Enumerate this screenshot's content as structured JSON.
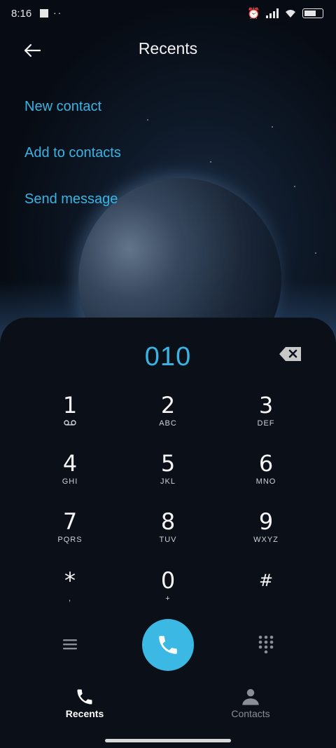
{
  "status_bar": {
    "time": "8:16"
  },
  "header": {
    "title": "Recents"
  },
  "menu": [
    {
      "label": "New contact"
    },
    {
      "label": "Add to contacts"
    },
    {
      "label": "Send message"
    }
  ],
  "dialer": {
    "number": "010",
    "keys": [
      {
        "digit": "1",
        "letters": ""
      },
      {
        "digit": "2",
        "letters": "ABC"
      },
      {
        "digit": "3",
        "letters": "DEF"
      },
      {
        "digit": "4",
        "letters": "GHI"
      },
      {
        "digit": "5",
        "letters": "JKL"
      },
      {
        "digit": "6",
        "letters": "MNO"
      },
      {
        "digit": "7",
        "letters": "PQRS"
      },
      {
        "digit": "8",
        "letters": "TUV"
      },
      {
        "digit": "9",
        "letters": "WXYZ"
      },
      {
        "digit": "*",
        "letters": ","
      },
      {
        "digit": "0",
        "letters": "+"
      },
      {
        "digit": "#",
        "letters": ""
      }
    ]
  },
  "tabs": [
    {
      "label": "Recents",
      "active": true
    },
    {
      "label": "Contacts",
      "active": false
    }
  ],
  "colors": {
    "accent": "#3ab4e2",
    "background": "#070c14",
    "panel": "#0a0f18"
  }
}
